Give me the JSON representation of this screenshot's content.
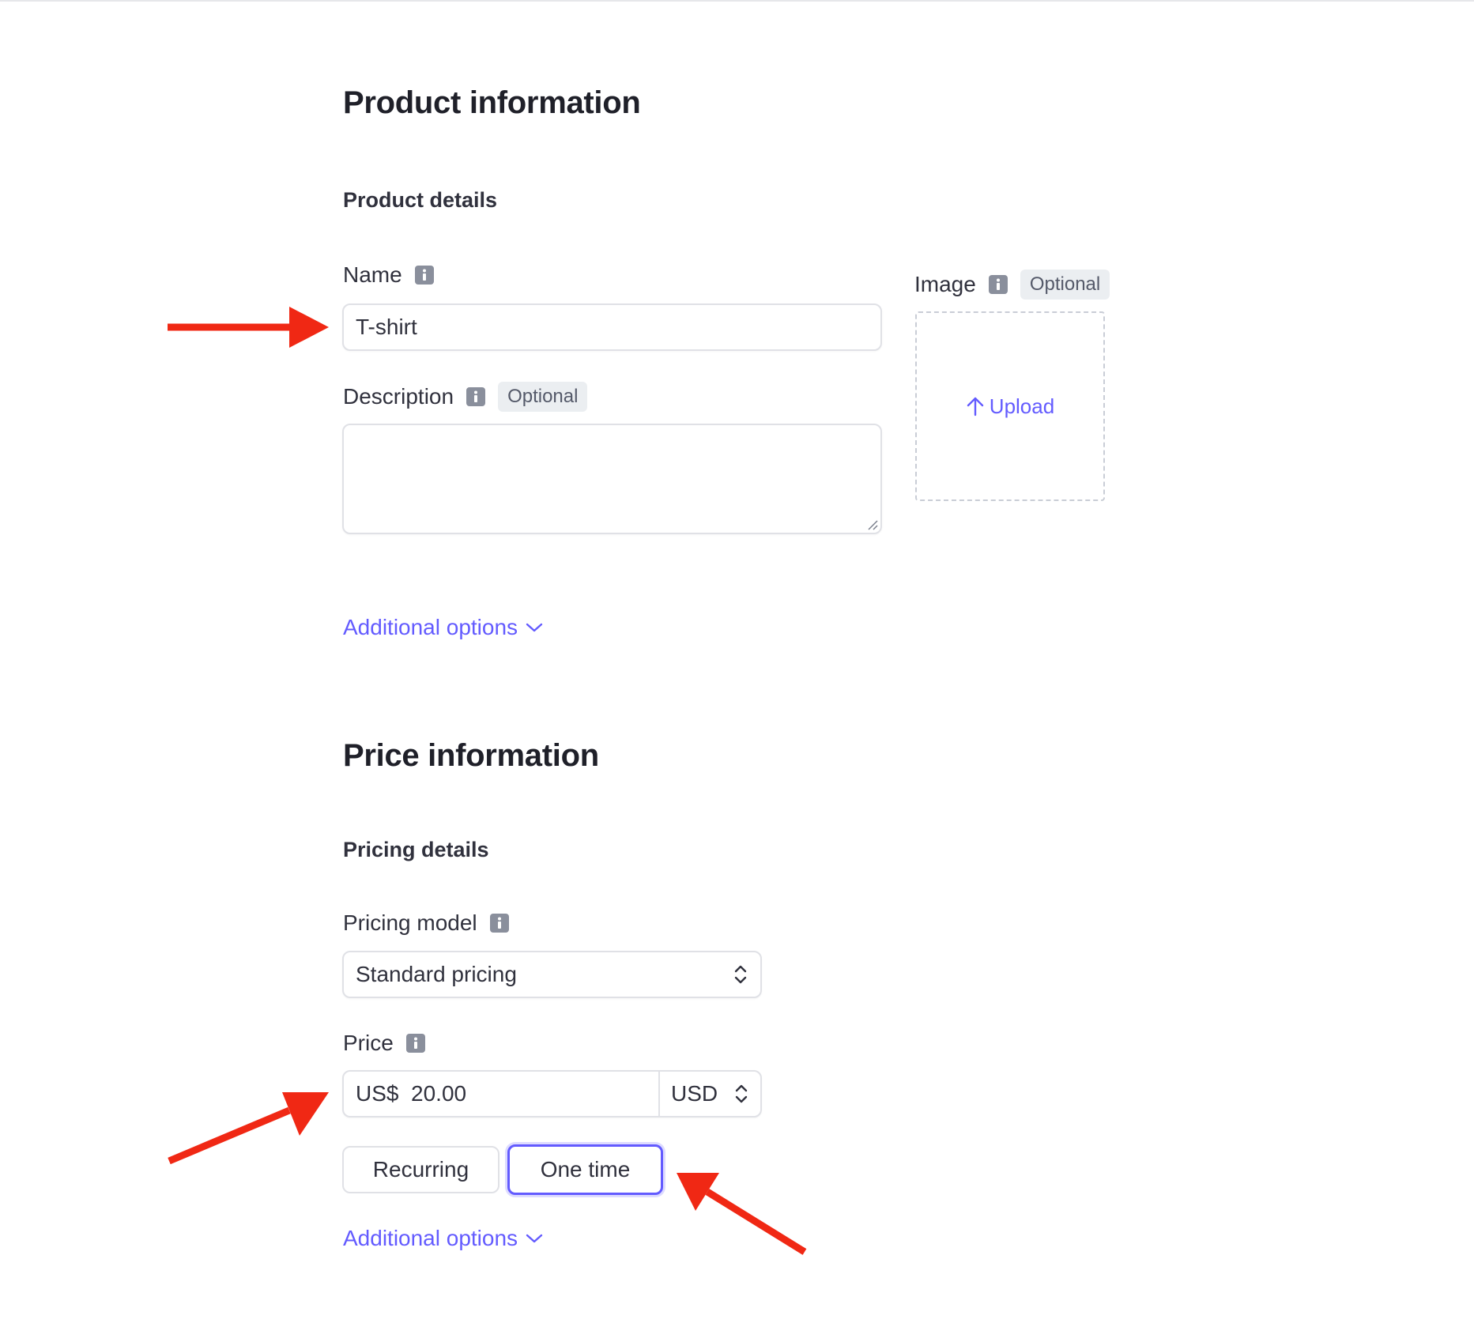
{
  "product_section": {
    "title": "Product information",
    "subtitle": "Product details",
    "name": {
      "label": "Name",
      "value": "T-shirt"
    },
    "description": {
      "label": "Description",
      "optional_badge": "Optional",
      "value": ""
    },
    "image": {
      "label": "Image",
      "optional_badge": "Optional",
      "upload_label": "Upload"
    },
    "additional_options": "Additional options"
  },
  "price_section": {
    "title": "Price information",
    "subtitle": "Pricing details",
    "pricing_model": {
      "label": "Pricing model",
      "value": "Standard pricing"
    },
    "price": {
      "label": "Price",
      "value": "US$  20.00",
      "currency": "USD"
    },
    "billing_types": [
      {
        "label": "Recurring",
        "selected": false
      },
      {
        "label": "One time",
        "selected": true
      }
    ],
    "additional_options": "Additional options"
  },
  "colors": {
    "accent": "#635bff",
    "annotation_arrow": "#f02814",
    "text": "#30313d",
    "border": "#e0e1e6"
  },
  "icons": [
    "info-icon",
    "upload-arrow-icon",
    "chevron-down-icon",
    "select-updown-icon",
    "resize-handle-icon"
  ]
}
